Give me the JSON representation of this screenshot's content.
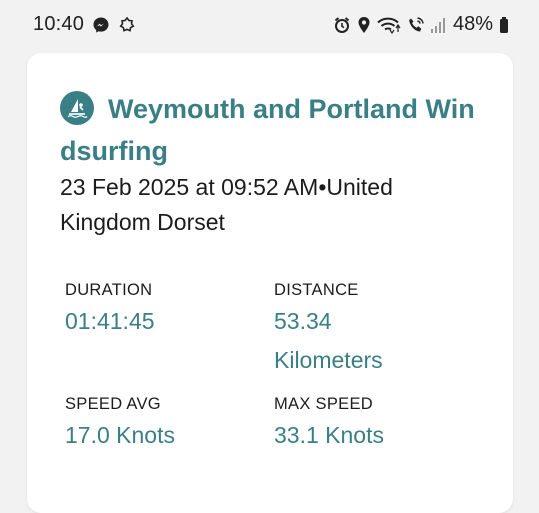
{
  "status_bar": {
    "time": "10:40",
    "battery": "48%"
  },
  "activity": {
    "title": "Weymouth and Portland Windsurfing",
    "date_line": "23 Feb 2025 at 09:52 AM",
    "separator": "•",
    "location": "United Kingdom Dorset",
    "activity_icon": "windsurfing-icon"
  },
  "stats": {
    "duration": {
      "label": "DURATION",
      "value": "01:41:45"
    },
    "distance": {
      "label": "DISTANCE",
      "value": "53.34 Kilometers"
    },
    "speed_avg": {
      "label": "SPEED AVG",
      "value": "17.0 Knots"
    },
    "max_speed": {
      "label": "MAX SPEED",
      "value": "33.1 Knots"
    }
  },
  "colors": {
    "accent": "#3a7f86",
    "text": "#1c1c1c",
    "background": "#f2f2f2",
    "card": "#ffffff"
  }
}
